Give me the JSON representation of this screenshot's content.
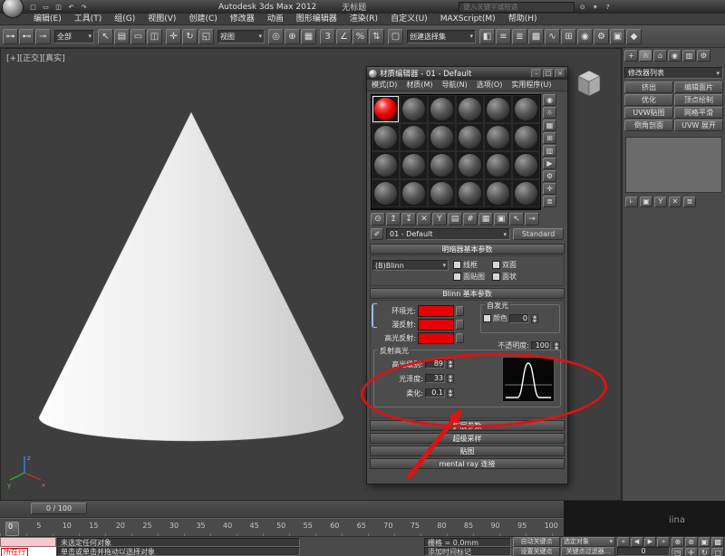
{
  "watermark": "iina",
  "colors": {
    "annotation_red": "#e01212",
    "material_red": "#e60000"
  },
  "titlebar": {
    "app_title": "Autodesk 3ds Max 2012",
    "doc_title": "无标题",
    "search_placeholder": "键入关键字或短语",
    "quick_icons": [
      {
        "name": "new-scene-icon",
        "glyph": "□"
      },
      {
        "name": "open-file-icon",
        "glyph": "▭"
      },
      {
        "name": "save-file-icon",
        "glyph": "◫"
      },
      {
        "name": "undo-icon",
        "glyph": "↶"
      },
      {
        "name": "redo-icon",
        "glyph": "↷"
      }
    ],
    "infocenter_icons": [
      {
        "name": "search-icon",
        "glyph": "⊙"
      },
      {
        "name": "infocenter-star-icon",
        "glyph": "✶"
      },
      {
        "name": "help-icon",
        "glyph": "?"
      }
    ]
  },
  "menubar": {
    "items": [
      "编辑(E)",
      "工具(T)",
      "组(G)",
      "视图(V)",
      "创建(C)",
      "修改器",
      "动画",
      "图形编辑器",
      "渲染(R)",
      "自定义(U)",
      "MAXScript(M)",
      "帮助(H)"
    ]
  },
  "toolbar": {
    "selection_filter": "全部",
    "coord_system": "视图",
    "named_selection": "创建选择集",
    "group1": [
      {
        "name": "select-and-link-icon",
        "glyph": "⊶"
      },
      {
        "name": "unlink-selection-icon",
        "glyph": "⊷"
      },
      {
        "name": "bind-to-space-warp-icon",
        "glyph": "⊸"
      }
    ],
    "group2": [
      {
        "name": "select-object-icon",
        "glyph": "↖"
      },
      {
        "name": "select-by-name-icon",
        "glyph": "▤"
      },
      {
        "name": "rectangular-selection-icon",
        "glyph": "▭"
      },
      {
        "name": "window-crossing-icon",
        "glyph": "◫"
      }
    ],
    "group3": [
      {
        "name": "select-and-move-icon",
        "glyph": "✛"
      },
      {
        "name": "select-and-rotate-icon",
        "glyph": "↻"
      },
      {
        "name": "select-and-scale-icon",
        "glyph": "◱"
      }
    ],
    "group4": [
      {
        "name": "use-pivot-center-icon",
        "glyph": "◎"
      },
      {
        "name": "select-and-manipulate-icon",
        "glyph": "⊕"
      },
      {
        "name": "keyboard-override-icon",
        "glyph": "▦"
      }
    ],
    "group5": [
      {
        "name": "snaps-toggle-icon",
        "glyph": "3"
      },
      {
        "name": "angle-snap-icon",
        "glyph": "∠"
      },
      {
        "name": "percent-snap-icon",
        "glyph": "%"
      },
      {
        "name": "spinner-snap-icon",
        "glyph": "⇅"
      }
    ],
    "group6": [
      {
        "name": "edit-named-selections-icon",
        "glyph": "▢"
      }
    ],
    "group7": [
      {
        "name": "mirror-icon",
        "glyph": "◧"
      },
      {
        "name": "align-icon",
        "glyph": "≡"
      },
      {
        "name": "layer-manager-icon",
        "glyph": "≣"
      },
      {
        "name": "graphite-ribbon-icon",
        "glyph": "▩"
      },
      {
        "name": "curve-editor-icon",
        "glyph": "∿"
      },
      {
        "name": "schematic-view-icon",
        "glyph": "⊞"
      },
      {
        "name": "material-editor-icon",
        "glyph": "◉"
      },
      {
        "name": "render-setup-icon",
        "glyph": "⚙"
      },
      {
        "name": "rendered-frame-icon",
        "glyph": "▣"
      },
      {
        "name": "render-icon",
        "glyph": "◆"
      }
    ]
  },
  "viewport": {
    "label": "[+][正交][真实]",
    "axis_x": "x",
    "axis_y": "y",
    "axis_z": "z"
  },
  "material_editor": {
    "title": "材质编辑器 - 01 - Default",
    "window_buttons": [
      {
        "name": "minimize-button",
        "glyph": "–"
      },
      {
        "name": "maximize-button",
        "glyph": "□"
      },
      {
        "name": "close-button",
        "glyph": "×"
      }
    ],
    "menu": [
      "模式(D)",
      "材质(M)",
      "导航(N)",
      "选项(O)",
      "实用程序(U)"
    ],
    "palette_slots": [
      "red",
      "gray",
      "gray",
      "gray",
      "gray",
      "gray",
      "gray",
      "gray",
      "gray",
      "gray",
      "gray",
      "gray",
      "gray",
      "gray",
      "gray",
      "gray",
      "gray",
      "gray",
      "gray",
      "gray",
      "gray",
      "gray",
      "gray",
      "gray"
    ],
    "side_toolbar": [
      {
        "name": "sample-type-icon",
        "glyph": "◉"
      },
      {
        "name": "backlight-icon",
        "glyph": "☼"
      },
      {
        "name": "background-icon",
        "glyph": "▦"
      },
      {
        "name": "sample-tiling-icon",
        "glyph": "⊞"
      },
      {
        "name": "video-color-check-icon",
        "glyph": "▥"
      },
      {
        "name": "make-preview-icon",
        "glyph": "▶"
      },
      {
        "name": "options-icon",
        "glyph": "⚙"
      },
      {
        "name": "select-by-material-icon",
        "glyph": "✛"
      },
      {
        "name": "material-map-navigator-icon",
        "glyph": "≣"
      }
    ],
    "bottom_toolbar": [
      {
        "name": "get-material-icon",
        "glyph": "⊙"
      },
      {
        "name": "put-to-scene-icon",
        "glyph": "↥"
      },
      {
        "name": "assign-to-selection-icon",
        "glyph": "↧"
      },
      {
        "name": "reset-map-icon",
        "glyph": "✕"
      },
      {
        "name": "make-unique-icon",
        "glyph": "Y"
      },
      {
        "name": "put-to-library-icon",
        "glyph": "▤"
      },
      {
        "name": "material-id-icon",
        "glyph": "#"
      },
      {
        "name": "show-in-viewport-icon",
        "glyph": "▦"
      },
      {
        "name": "show-end-result-icon",
        "glyph": "▣"
      },
      {
        "name": "go-to-parent-icon",
        "glyph": "↖"
      },
      {
        "name": "go-forward-icon",
        "glyph": "→"
      }
    ],
    "picker_glyph": "✐",
    "material_name": "01 - Default",
    "material_type": "Standard",
    "shader_rollout": {
      "title": "明暗器基本参数",
      "shader": "(B)Blinn",
      "checkboxes": [
        "线框",
        "双面",
        "面贴图",
        "面状"
      ]
    },
    "blinn_rollout": {
      "title": "Blinn 基本参数",
      "color_rows": [
        {
          "label": "环境光:"
        },
        {
          "label": "漫反射:"
        },
        {
          "label": "高光反射:"
        }
      ],
      "self_illumination": {
        "group_label": "自发光",
        "checkbox_label": "颜色",
        "value": "0"
      },
      "opacity": {
        "label": "不透明度:",
        "value": "100"
      },
      "specular": {
        "group_label": "反射高光",
        "rows": [
          {
            "label": "高光级别:",
            "value": "89"
          },
          {
            "label": "光泽度:",
            "value": "33"
          },
          {
            "label": "柔化:",
            "value": "0.1"
          }
        ]
      }
    },
    "collapsed_rollouts": [
      "扩展参数",
      "超级采样",
      "贴图",
      "mental ray 连接"
    ]
  },
  "command_panel": {
    "tabs": [
      {
        "name": "tab-create",
        "glyph": "+",
        "state": "normal"
      },
      {
        "name": "tab-modify",
        "glyph": "∩",
        "state": "active"
      },
      {
        "name": "tab-hierarchy",
        "glyph": "⌂",
        "state": "normal"
      },
      {
        "name": "tab-motion",
        "glyph": "◉",
        "state": "normal"
      },
      {
        "name": "tab-display",
        "glyph": "▥",
        "state": "normal"
      },
      {
        "name": "tab-utilities",
        "glyph": "⚙",
        "state": "normal"
      }
    ],
    "modifier_list_label": "修改器列表",
    "modifier_buttons": [
      "挤出",
      "编辑面片",
      "优化",
      "顶点绘制",
      "UVW贴图",
      "网格平滑",
      "倒角剖面",
      "UVW 展开"
    ],
    "stack_tools": [
      {
        "name": "pin-stack-icon",
        "glyph": "⊦"
      },
      {
        "name": "show-end-result-icon",
        "glyph": "▣"
      },
      {
        "name": "make-unique-icon",
        "glyph": "Y"
      },
      {
        "name": "remove-modifier-icon",
        "glyph": "✕"
      },
      {
        "name": "configure-modifier-sets-icon",
        "glyph": "≣"
      }
    ]
  },
  "timeline": {
    "slider_label": "0 / 100",
    "ticks": [
      "0",
      "5",
      "10",
      "15",
      "20",
      "25",
      "30",
      "35",
      "40",
      "45",
      "50",
      "55",
      "60",
      "65",
      "70",
      "75",
      "80",
      "85",
      "90",
      "95",
      "100"
    ]
  },
  "statusbar": {
    "listener_tag": "所在行",
    "status_line": "未选定任何对象",
    "prompt_line": "单击或单击并拖动以选择对象",
    "grid_label": "栅格 = 0.0mm",
    "time_tag_label": "添加时间标记",
    "auto_key_label": "自动关键点",
    "set_key_label": "设置关键点",
    "selected_label": "选定对象",
    "key_filters_label": "关键点过滤器...",
    "frame_value": "0",
    "playback_icons": [
      {
        "name": "go-start-icon",
        "glyph": "«"
      },
      {
        "name": "prev-frame-icon",
        "glyph": "◀"
      },
      {
        "name": "play-icon",
        "glyph": "▶"
      },
      {
        "name": "go-end-icon",
        "glyph": "»"
      }
    ],
    "nav_icons": [
      {
        "name": "zoom-icon",
        "glyph": "⊕"
      },
      {
        "name": "zoom-all-icon",
        "glyph": "⊛"
      },
      {
        "name": "zoom-extents-icon",
        "glyph": "▣"
      },
      {
        "name": "zoom-extents-all-icon",
        "glyph": "▩"
      },
      {
        "name": "zoom-region-icon",
        "glyph": "◳"
      },
      {
        "name": "pan-icon",
        "glyph": "✛"
      },
      {
        "name": "orbit-icon",
        "glyph": "↻"
      },
      {
        "name": "maximize-viewport-icon",
        "glyph": "□"
      }
    ]
  }
}
